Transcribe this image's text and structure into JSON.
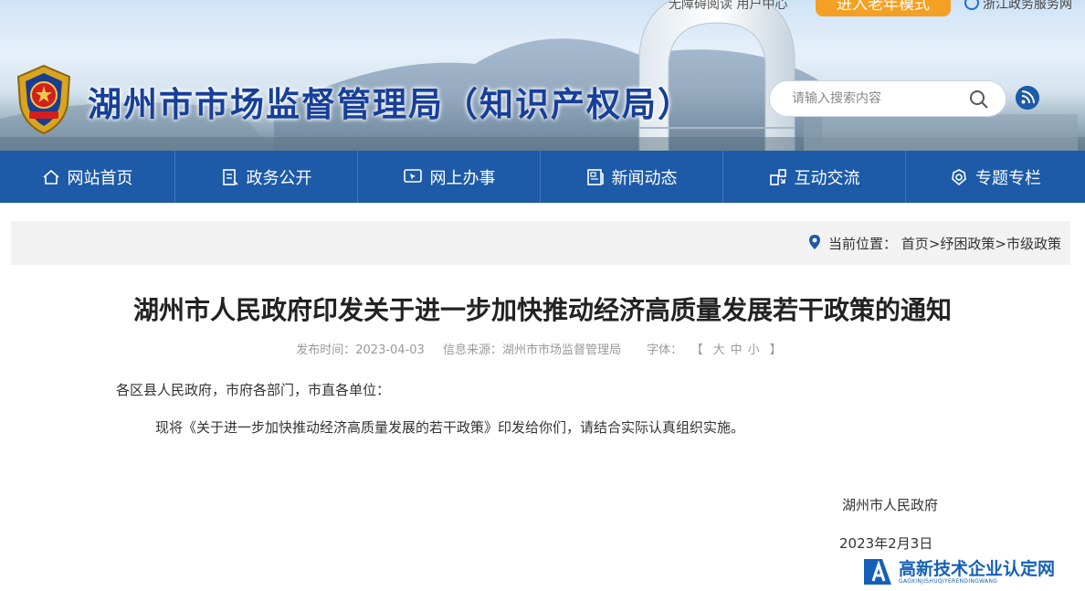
{
  "header": {
    "top_links": "无障碍阅读  用户中心",
    "elder_mode": "进入老年模式",
    "gov_service": "浙江政务服务网",
    "site_title": "湖州市市场监督管理局（知识产权局）",
    "search_placeholder": "请输入搜索内容"
  },
  "nav": {
    "items": [
      {
        "label": "网站首页",
        "icon": "home-icon"
      },
      {
        "label": "政务公开",
        "icon": "document-icon"
      },
      {
        "label": "网上办事",
        "icon": "cursor-screen-icon"
      },
      {
        "label": "新闻动态",
        "icon": "news-icon"
      },
      {
        "label": "互动交流",
        "icon": "interaction-icon"
      },
      {
        "label": "专题专栏",
        "icon": "gear-badge-icon"
      }
    ]
  },
  "breadcrumb": {
    "prefix": "当前位置：",
    "items": [
      "首页",
      "纾困政策",
      "市级政策"
    ],
    "separator": ">"
  },
  "article": {
    "title": "湖州市人民政府印发关于进一步加快推动经济高质量发展若干政策的通知",
    "publish_time": "发布时间：2023-04-03",
    "source": "信息来源：湖州市市场监督管理局",
    "font_label": "字体：",
    "font_open": "【",
    "font_large": "大",
    "font_medium": "中",
    "font_small": "小",
    "font_close": "】",
    "salutation": "各区县人民政府，市府各部门，市直各单位：",
    "body": "现将《关于进一步加快推动经济高质量发展的若干政策》印发给你们，请结合实际认真组织实施。",
    "signature": "湖州市人民政府",
    "date": "2023年2月3日"
  },
  "watermark": {
    "title": "高新技术企业认定网",
    "subtitle": "GAOXINJISHUQIYERENDINGWANG"
  },
  "colors": {
    "nav_bg": "#1d5aa8",
    "title_blue": "#173f99",
    "elder_orange": "#f4a024"
  }
}
